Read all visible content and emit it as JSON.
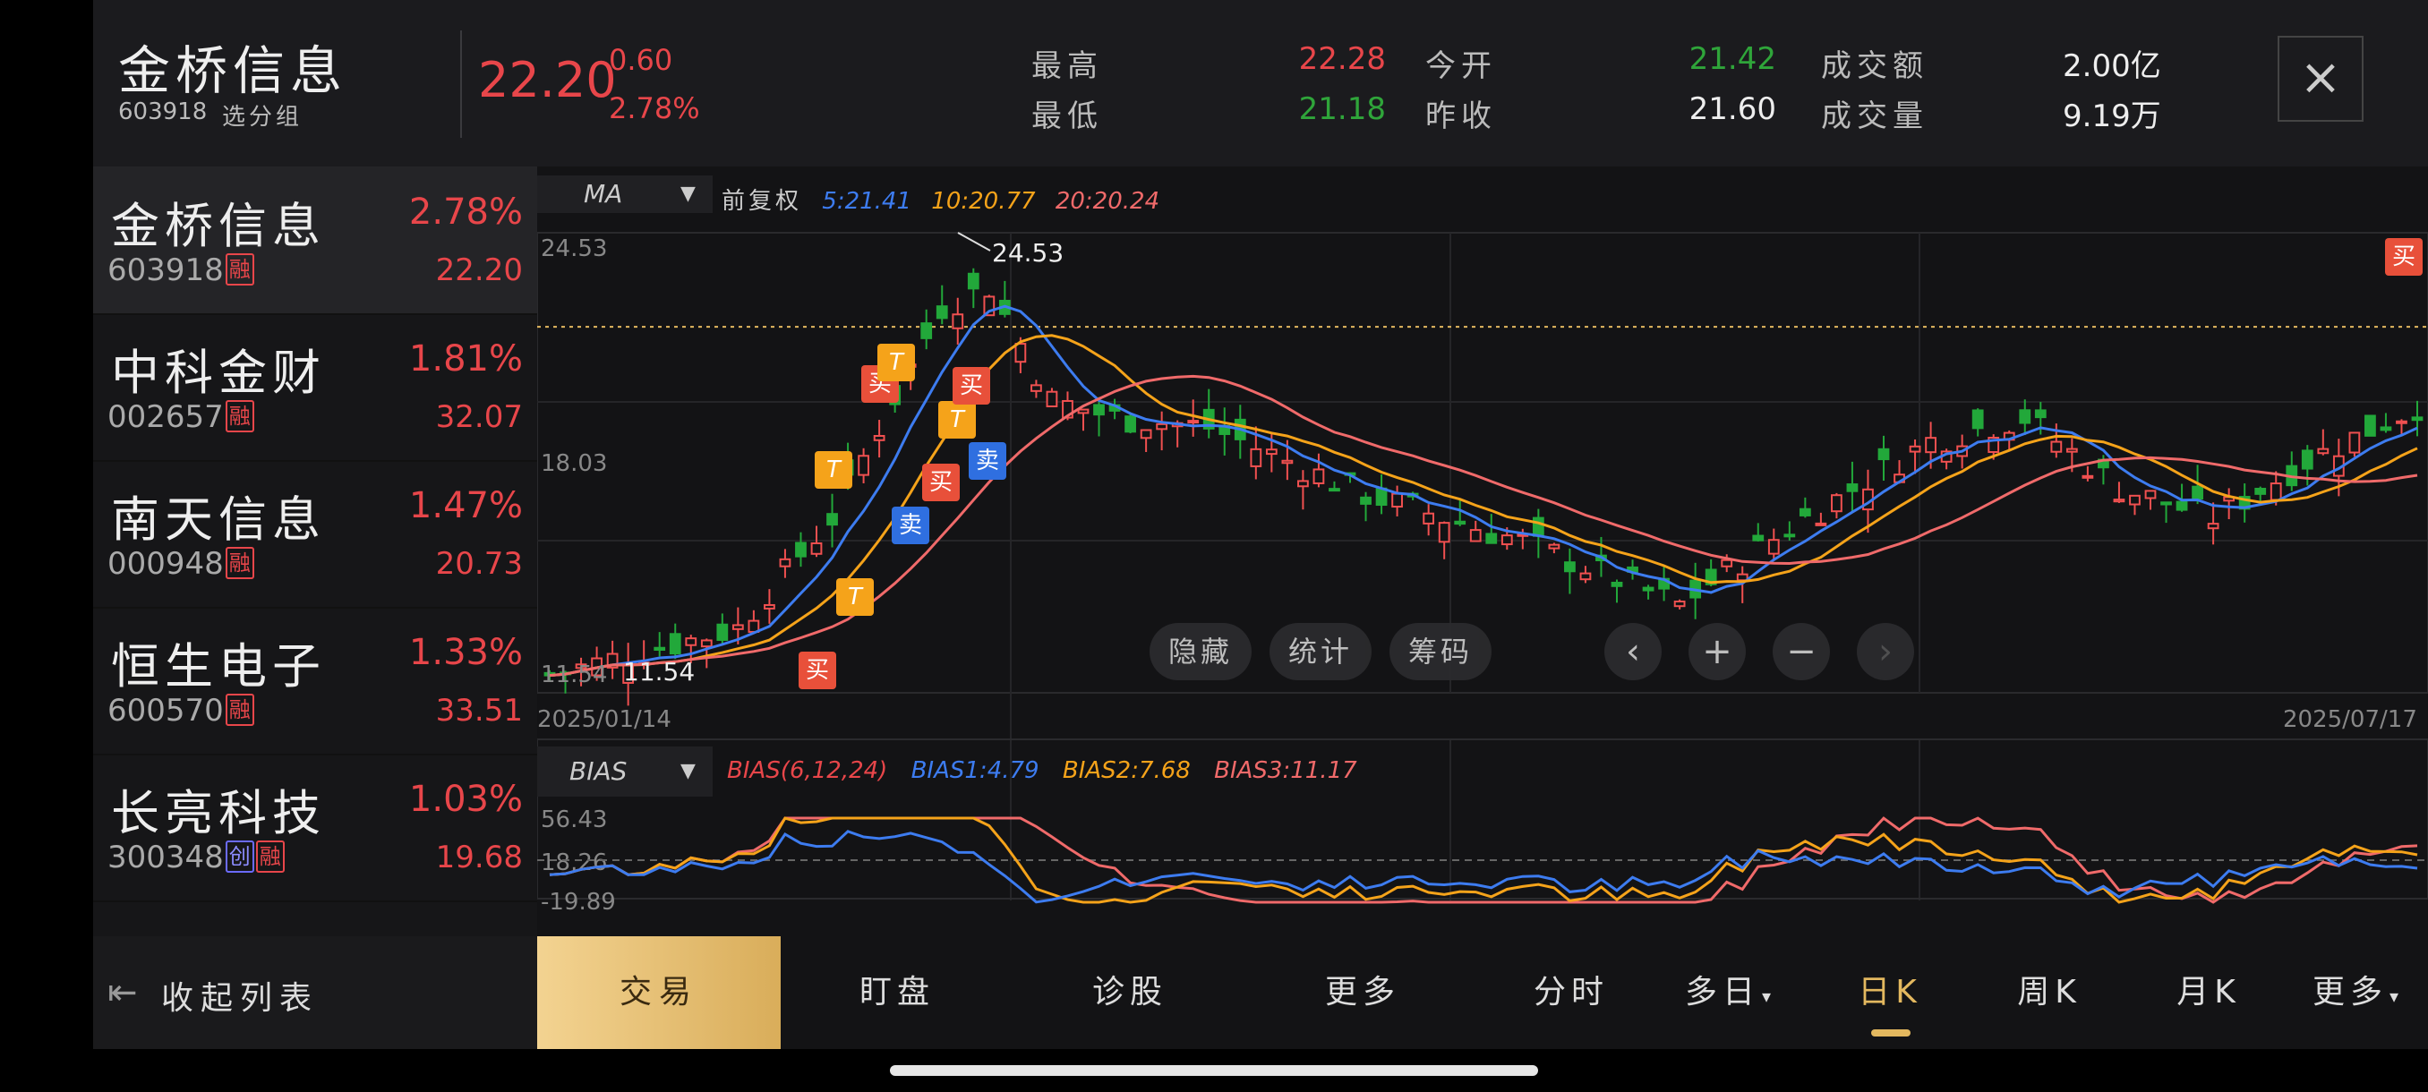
{
  "header": {
    "name": "金桥信息",
    "code": "603918",
    "group_label": "选分组",
    "price": "22.20",
    "change": "0.60",
    "change_pct": "2.78%",
    "quotes": [
      {
        "label": "最高",
        "value": "22.28",
        "color": "#e8464a"
      },
      {
        "label": "最低",
        "value": "21.18",
        "color": "#2fa53a"
      },
      {
        "label": "今开",
        "value": "21.42",
        "color": "#2fa53a"
      },
      {
        "label": "昨收",
        "value": "21.60",
        "color": "#eeeeee"
      },
      {
        "label": "成交额",
        "value": "2.00亿",
        "color": "#eeeeee"
      },
      {
        "label": "成交量",
        "value": "9.19万",
        "color": "#eeeeee"
      }
    ],
    "close_icon": "×"
  },
  "watchlist": [
    {
      "name": "金桥信息",
      "code": "603918",
      "tags": [
        "融"
      ],
      "pct": "2.78%",
      "price": "22.20",
      "selected": true
    },
    {
      "name": "中科金财",
      "code": "002657",
      "tags": [
        "融"
      ],
      "pct": "1.81%",
      "price": "32.07"
    },
    {
      "name": "南天信息",
      "code": "000948",
      "tags": [
        "融"
      ],
      "pct": "1.47%",
      "price": "20.73"
    },
    {
      "name": "恒生电子",
      "code": "600570",
      "tags": [
        "融"
      ],
      "pct": "1.33%",
      "price": "33.51"
    },
    {
      "name": "长亮科技",
      "code": "300348",
      "tags": [
        "创",
        "融"
      ],
      "pct": "1.03%",
      "price": "19.68"
    }
  ],
  "collapse": {
    "icon": "collapse-list-icon",
    "label": "收起列表"
  },
  "chart": {
    "indicator": "MA",
    "adjust": "前复权",
    "ma": [
      {
        "text": "5:21.41",
        "color": "#3d7cf0"
      },
      {
        "text": "10:20.77",
        "color": "#f5a31a"
      },
      {
        "text": "20:20.24",
        "color": "#f06a6a"
      }
    ],
    "y_labels": {
      "top": "24.53",
      "mid": "18.03",
      "low": "11.54"
    },
    "high_label": "24.53",
    "low_label": "11.54",
    "date_start": "2025/01/14",
    "date_end": "2025/07/17",
    "controls": {
      "hide": "隐藏",
      "stats": "统计",
      "chips": "筹码",
      "prev": "‹",
      "zoom_in": "+",
      "zoom_out": "−",
      "next": "›"
    },
    "signals": {
      "buy": "买",
      "sell": "卖",
      "t": "T"
    },
    "bias_indicator": "BIAS",
    "bias": [
      {
        "text": "BIAS(6,12,24)",
        "color": "#e8464a"
      },
      {
        "text": "BIAS1:4.79",
        "color": "#3d7cf0"
      },
      {
        "text": "BIAS2:7.68",
        "color": "#f5a31a"
      },
      {
        "text": "BIAS3:11.17",
        "color": "#f06a6a"
      }
    ],
    "bias_labels": {
      "top": "56.43",
      "mid": "18.26",
      "low": "-19.89"
    }
  },
  "chart_data": {
    "type": "candlestick",
    "x_range": [
      "2025/01/14",
      "2025/07/17"
    ],
    "ylim": [
      11.54,
      24.53
    ],
    "period_high": 24.53,
    "period_low": 11.54,
    "last": {
      "open": 21.42,
      "high": 22.28,
      "low": 21.18,
      "close": 22.2,
      "prev_close": 21.6
    },
    "ma": {
      "MA5": 21.41,
      "MA10": 20.77,
      "MA20": 20.24
    },
    "bias": {
      "BIAS1": 4.79,
      "BIAS2": 7.68,
      "BIAS3": 11.17,
      "ylim": [
        -19.89,
        56.43
      ],
      "mid": 18.26
    }
  },
  "tabs": {
    "trade": "交易",
    "items": [
      "盯盘",
      "诊股",
      "更多"
    ],
    "periods": [
      "分时",
      "多日",
      "日K",
      "周K",
      "月K",
      "更多"
    ],
    "active": "日K"
  }
}
